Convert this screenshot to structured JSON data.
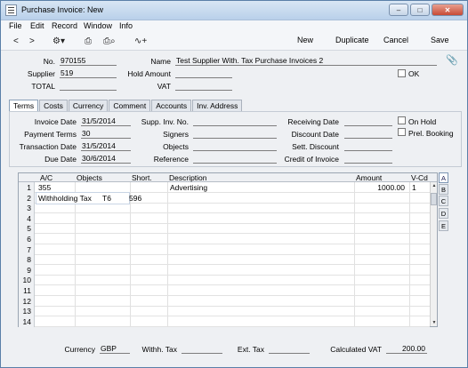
{
  "window": {
    "title": "Purchase Invoice: New"
  },
  "menu": [
    "File",
    "Edit",
    "Record",
    "Window",
    "Info"
  ],
  "toolbar": {
    "new": "New",
    "duplicate": "Duplicate",
    "cancel": "Cancel",
    "save": "Save"
  },
  "header": {
    "no_label": "No.",
    "no": "970155",
    "name_label": "Name",
    "name": "Test Supplier With. Tax Purchase Invoices 2",
    "supplier_label": "Supplier",
    "supplier": "519",
    "hold_amount_label": "Hold Amount",
    "hold_amount": "",
    "ok_label": "OK",
    "total_label": "TOTAL",
    "total": "",
    "vat_label": "VAT",
    "vat": ""
  },
  "tabs": [
    "Terms",
    "Costs",
    "Currency",
    "Comment",
    "Accounts",
    "Inv. Address"
  ],
  "terms": {
    "invoice_date_label": "Invoice Date",
    "invoice_date": "31/5/2014",
    "payment_terms_label": "Payment Terms",
    "payment_terms": "30",
    "transaction_date_label": "Transaction Date",
    "transaction_date": "31/5/2014",
    "due_date_label": "Due Date",
    "due_date": "30/6/2014",
    "supp_inv_label": "Supp. Inv. No.",
    "signers_label": "Signers",
    "objects_label": "Objects",
    "reference_label": "Reference",
    "receiving_date_label": "Receiving Date",
    "discount_date_label": "Discount Date",
    "sett_discount_label": "Sett. Discount",
    "credit_invoice_label": "Credit of Invoice",
    "on_hold_label": "On Hold",
    "prel_booking_label": "Prel. Booking"
  },
  "grid": {
    "columns": [
      "A/C",
      "Objects",
      "Short.",
      "Description",
      "Amount",
      "V-Cd"
    ],
    "rows": [
      {
        "n": "1",
        "ac": "355",
        "objects": "",
        "short": "",
        "description": "Advertising",
        "amount": "1000.00",
        "vcd": "1"
      },
      {
        "n": "2",
        "ac": "Withholding Tax",
        "objects": "T6",
        "short": "596",
        "description": "",
        "amount": "",
        "vcd": ""
      },
      {
        "n": "3"
      },
      {
        "n": "4"
      },
      {
        "n": "5"
      },
      {
        "n": "6"
      },
      {
        "n": "7"
      },
      {
        "n": "8"
      },
      {
        "n": "9"
      },
      {
        "n": "10"
      },
      {
        "n": "11"
      },
      {
        "n": "12"
      },
      {
        "n": "13"
      },
      {
        "n": "14"
      }
    ],
    "side_tabs": [
      "A",
      "B",
      "C",
      "D",
      "E"
    ]
  },
  "footer": {
    "currency_label": "Currency",
    "currency": "GBP",
    "withh_tax_label": "Withh. Tax",
    "withh_tax": "",
    "ext_tax_label": "Ext. Tax",
    "ext_tax": "",
    "calc_vat_label": "Calculated VAT",
    "calc_vat": "200.00"
  }
}
